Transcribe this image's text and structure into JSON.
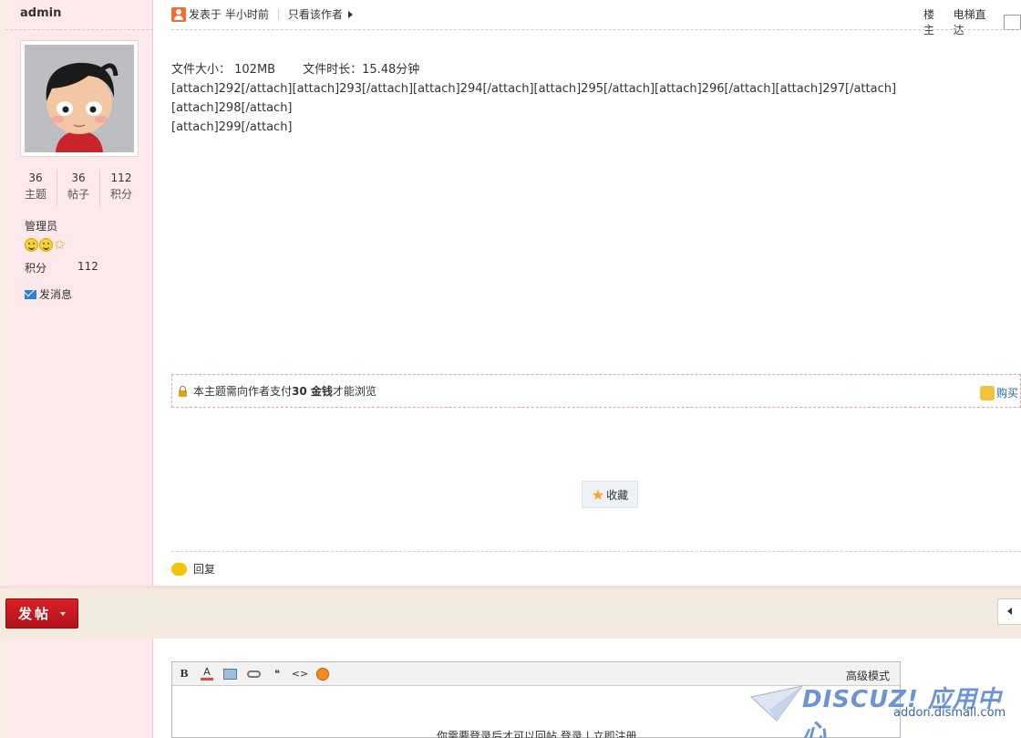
{
  "author": {
    "name": "admin",
    "stats": [
      {
        "value": "36",
        "label": "主题"
      },
      {
        "value": "36",
        "label": "帖子"
      },
      {
        "value": "112",
        "label": "积分"
      }
    ],
    "group": "管理员",
    "credit_label": "积分",
    "credit_value": "112",
    "send_message": "发消息"
  },
  "post_header": {
    "posted_time": "发表于 半小时前",
    "only_author": "只看该作者",
    "floor": "楼主",
    "jump": "电梯直达"
  },
  "content": {
    "line1_size": "文件大小：  102MB",
    "line1_duration": "文件时长：15.48分钟",
    "line2": "[attach]292[/attach][attach]293[/attach][attach]294[/attach][attach]295[/attach][attach]296[/attach][attach]297[/attach][attach]298[/attach]",
    "line3": "[attach]299[/attach]"
  },
  "paywall": {
    "text_before": "本主题需向作者支付 ",
    "amount": "30 金钱",
    "text_after": " 才能浏览",
    "buy_label": "购买"
  },
  "favorite_label": "收藏",
  "reply_label": "回复",
  "post_button_label": "发帖",
  "editor": {
    "advanced_mode": "高级模式",
    "login_tip": "你需要登录后才可以回帖 登录 | 立即注册"
  },
  "watermark": {
    "brand": "DISCUZ! 应用中心",
    "url": "addon.dismall.com"
  },
  "colors": {
    "sidebar_bg": "#fde9ec",
    "post_button": "#c8161d",
    "link": "#2366a8"
  }
}
